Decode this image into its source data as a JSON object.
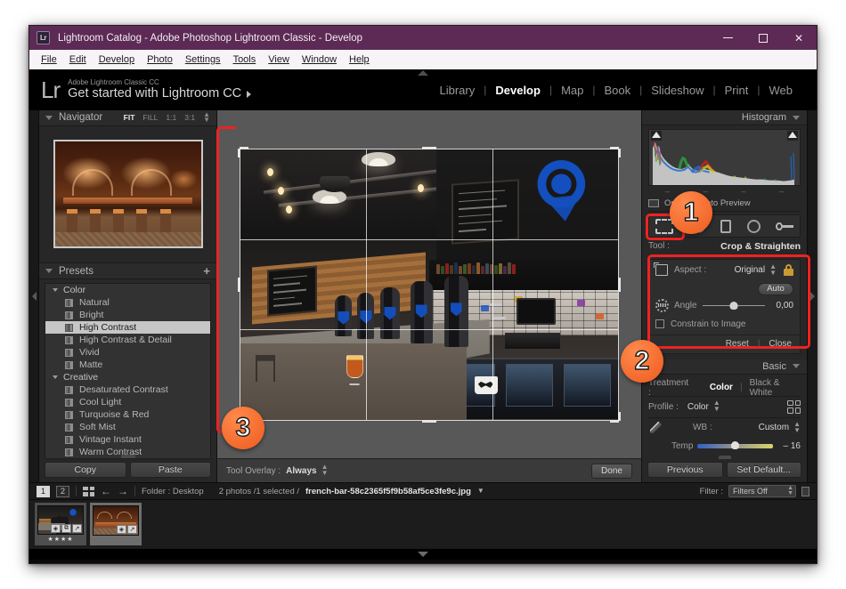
{
  "window": {
    "title": "Lightroom Catalog - Adobe Photoshop Lightroom Classic - Develop",
    "badge": "Lr",
    "minimize": "minimize-icon",
    "maximize": "maximize-icon",
    "close": "✕"
  },
  "menubar": [
    {
      "label": "File"
    },
    {
      "label": "Edit"
    },
    {
      "label": "Develop"
    },
    {
      "label": "Photo"
    },
    {
      "label": "Settings"
    },
    {
      "label": "Tools"
    },
    {
      "label": "View"
    },
    {
      "label": "Window"
    },
    {
      "label": "Help"
    }
  ],
  "identity": {
    "logo": "Lr",
    "subtitle": "Adobe Lightroom Classic CC",
    "title": "Get started with Lightroom CC"
  },
  "modules": [
    {
      "label": "Library",
      "active": false
    },
    {
      "label": "Develop",
      "active": true
    },
    {
      "label": "Map",
      "active": false
    },
    {
      "label": "Book",
      "active": false
    },
    {
      "label": "Slideshow",
      "active": false
    },
    {
      "label": "Print",
      "active": false
    },
    {
      "label": "Web",
      "active": false
    }
  ],
  "navigator": {
    "title": "Navigator",
    "zoom_options": [
      {
        "label": "FIT",
        "active": true
      },
      {
        "label": "FILL",
        "active": false
      },
      {
        "label": "1:1",
        "active": false
      },
      {
        "label": "3:1",
        "active": false
      }
    ]
  },
  "presets": {
    "title": "Presets",
    "add_label": "+",
    "groups": [
      {
        "name": "Color",
        "items": [
          {
            "label": "Natural",
            "selected": false
          },
          {
            "label": "Bright",
            "selected": false
          },
          {
            "label": "High Contrast",
            "selected": true
          },
          {
            "label": "High Contrast & Detail",
            "selected": false
          },
          {
            "label": "Vivid",
            "selected": false
          },
          {
            "label": "Matte",
            "selected": false
          }
        ]
      },
      {
        "name": "Creative",
        "items": [
          {
            "label": "Desaturated Contrast",
            "selected": false
          },
          {
            "label": "Cool Light",
            "selected": false
          },
          {
            "label": "Turquoise & Red",
            "selected": false
          },
          {
            "label": "Soft Mist",
            "selected": false
          },
          {
            "label": "Vintage Instant",
            "selected": false
          },
          {
            "label": "Warm Contrast",
            "selected": false
          }
        ]
      }
    ],
    "copy_label": "Copy",
    "paste_label": "Paste"
  },
  "toolbar": {
    "overlay_label": "Tool Overlay :",
    "overlay_value": "Always",
    "done_label": "Done"
  },
  "histogram": {
    "title": "Histogram",
    "ticks": [
      "–",
      "–",
      "–",
      "–"
    ],
    "rgb_label": "Original Photo Preview"
  },
  "tools": {
    "label": "Tool :",
    "value": "Crop & Straighten",
    "icons": [
      {
        "name": "crop-tool-icon",
        "active": true
      },
      {
        "name": "spot-removal-icon",
        "active": false
      },
      {
        "name": "red-eye-icon",
        "active": false
      },
      {
        "name": "graduated-filter-icon",
        "active": false
      },
      {
        "name": "adjustment-brush-icon",
        "active": false
      }
    ]
  },
  "crop_panel": {
    "aspect_label": "Aspect :",
    "aspect_value": "Original",
    "lock_icon": "lock-icon",
    "auto_label": "Auto",
    "angle_label": "Angle",
    "angle_value": "0,00",
    "constrain_label": "Constrain to Image",
    "reset_label": "Reset",
    "close_label": "Close"
  },
  "basic": {
    "title": "Basic",
    "treatment_label": "Treatment :",
    "treatment_color": "Color",
    "treatment_bw": "Black & White",
    "profile_label": "Profile :",
    "profile_value": "Color",
    "wb_label": "WB :",
    "wb_value": "Custom",
    "temp_label": "Temp",
    "temp_value": "– 16",
    "previous_label": "Previous",
    "set_default_label": "Set Default..."
  },
  "filmstrip": {
    "page_numbers": [
      {
        "label": "1",
        "active": true
      },
      {
        "label": "2",
        "active": false
      }
    ],
    "folder_label": "Folder : Desktop",
    "photo_count": "2 photos /1 selected /",
    "filename": "french-bar-58c2365f5f9b58af5ce3fe9c.jpg",
    "filter_label": "Filter :",
    "filter_value": "Filters Off",
    "thumbs": [
      {
        "name": "thumb-french-bar",
        "stars": "★★★★",
        "badges": [
          "◈",
          "⧉",
          "↗"
        ]
      },
      {
        "name": "thumb-classic-bar",
        "stars": "",
        "badges": [
          "◈",
          "↗"
        ]
      }
    ]
  },
  "annotations": [
    {
      "number": "1",
      "target": "crop-tool-icon"
    },
    {
      "number": "2",
      "target": "crop-panel"
    },
    {
      "number": "3",
      "target": "crop-left-edge"
    }
  ],
  "colors": {
    "accent": "#ee5a1e",
    "highlight": "#ee2222",
    "titlebar": "#5c2a54",
    "panel": "#272727"
  }
}
